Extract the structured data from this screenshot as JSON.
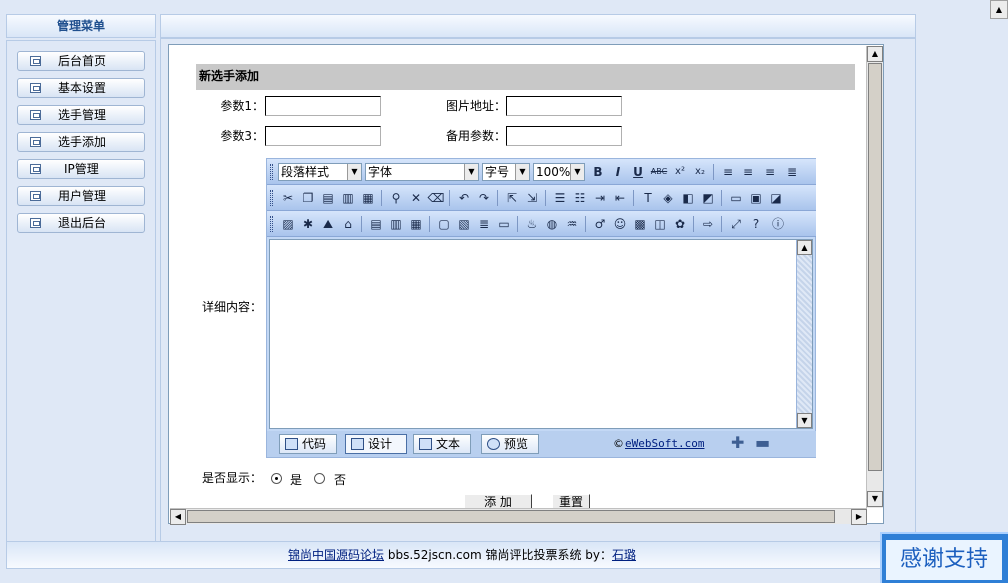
{
  "menu": {
    "title": "管理菜单",
    "items": [
      {
        "label": "后台首页"
      },
      {
        "label": "基本设置"
      },
      {
        "label": "选手管理"
      },
      {
        "label": "选手添加"
      },
      {
        "label": "IP管理"
      },
      {
        "label": "用户管理"
      },
      {
        "label": "退出后台"
      }
    ]
  },
  "form": {
    "heading": "新选手添加",
    "param1_label": "参数1：",
    "image_url_label": "图片地址：",
    "param3_label": "参数3：",
    "backup_param_label": "备用参数：",
    "detail_label": "详细内容：",
    "display_label": "是否显示：",
    "yes_label": "是",
    "no_label": "否",
    "display_selected": "是",
    "add_button": "添 加",
    "reset_button": "重置"
  },
  "editor": {
    "paragraph_style": "段落样式",
    "font": "字体",
    "font_size": "字号",
    "zoom": "100%",
    "modes": [
      "代码",
      "设计",
      "文本",
      "预览"
    ],
    "active_mode": "设计",
    "copyright_symbol": "©",
    "copyright_link": "eWebSoft.com",
    "format_buttons": [
      "B",
      "I",
      "U",
      "ABC",
      "x²",
      "x₂"
    ]
  },
  "footer": {
    "link1": "锦尚中国源码论坛",
    "text": "bbs.52jscn.com 锦尚评比投票系统 by：",
    "link2": "石璐"
  },
  "badge": {
    "text": "感谢支持"
  }
}
